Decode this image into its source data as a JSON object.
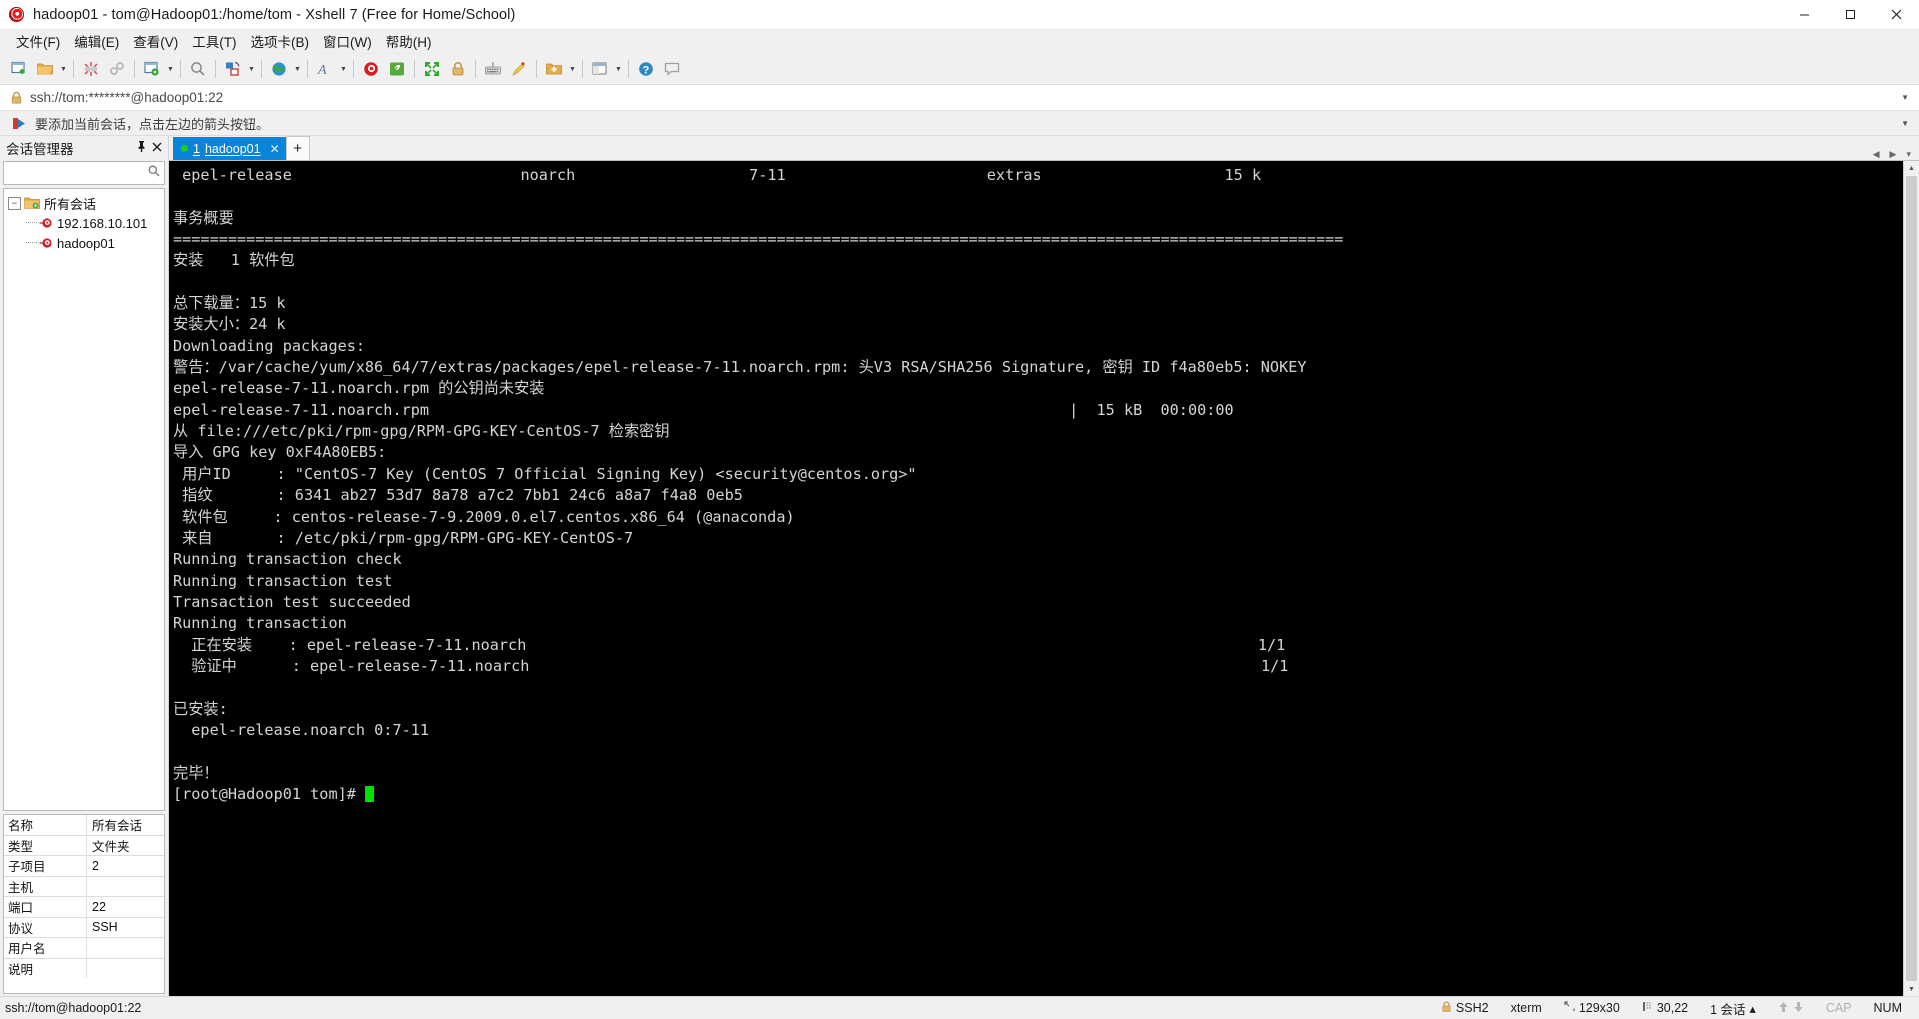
{
  "window": {
    "title": "hadoop01 - tom@Hadoop01:/home/tom - Xshell 7 (Free for Home/School)",
    "app_icon": "xshell-spiral-icon",
    "minimize_label": "─",
    "maximize_label": "☐",
    "close_label": "✕"
  },
  "menu": {
    "items": [
      {
        "label": "文件(F)",
        "name": "menu-file"
      },
      {
        "label": "编辑(E)",
        "name": "menu-edit"
      },
      {
        "label": "查看(V)",
        "name": "menu-view"
      },
      {
        "label": "工具(T)",
        "name": "menu-tools"
      },
      {
        "label": "选项卡(B)",
        "name": "menu-tabs"
      },
      {
        "label": "窗口(W)",
        "name": "menu-window"
      },
      {
        "label": "帮助(H)",
        "name": "menu-help"
      }
    ]
  },
  "toolbar": {
    "buttons": [
      "new-session-icon",
      "open-folder-icon",
      "separator",
      "disconnect-icon",
      "link-icon",
      "separator",
      "session-properties-icon",
      "separator",
      "find-icon",
      "separator",
      "transfer-icon",
      "separator",
      "globe-icon",
      "separator",
      "font-icon",
      "separator",
      "xshell-icon",
      "xftp-icon",
      "separator",
      "fullscreen-icon",
      "lock-icon",
      "separator",
      "keyboard-icon",
      "highlighter-icon",
      "separator",
      "add-to-folder-icon",
      "separator",
      "layout-icon",
      "separator",
      "help-icon",
      "comment-icon"
    ]
  },
  "address": {
    "lock_icon": "lock-icon",
    "value": "ssh://tom:********@hadoop01:22",
    "caret_icon": "chevron-down-icon"
  },
  "notice": {
    "icon": "red-arrow-icon",
    "text": "要添加当前会话，点击左边的箭头按钮。",
    "caret_icon": "chevron-down-icon"
  },
  "sidebar": {
    "title": "会话管理器",
    "pin_icon": "pin-icon",
    "close_icon": "close-icon",
    "search_placeholder": "",
    "search_icon": "search-icon",
    "tree": {
      "root": {
        "label": "所有会话",
        "icon": "folder-icon",
        "expander": "−"
      },
      "children": [
        {
          "label": "192.168.10.101",
          "icon": "session-icon"
        },
        {
          "label": "hadoop01",
          "icon": "session-icon"
        }
      ]
    },
    "properties": [
      {
        "key": "名称",
        "value": "所有会话"
      },
      {
        "key": "类型",
        "value": "文件夹"
      },
      {
        "key": "子项目",
        "value": "2"
      },
      {
        "key": "主机",
        "value": ""
      },
      {
        "key": "端口",
        "value": "22"
      },
      {
        "key": "协议",
        "value": "SSH"
      },
      {
        "key": "用户名",
        "value": ""
      },
      {
        "key": "说明",
        "value": ""
      }
    ]
  },
  "tabs": {
    "active": {
      "index": "1",
      "label": "hadoop01",
      "close_label": "✕",
      "status_dot": "connected"
    },
    "new_tab_label": "+",
    "nav_left": "◀",
    "nav_right": "▶",
    "nav_menu": "▾"
  },
  "terminal": {
    "lines": [
      " epel-release                         noarch                   7-11                      extras                    15 k",
      "",
      "事务概要",
      "================================================================================================================================",
      "安装   1 软件包",
      "",
      "总下载量：15 k",
      "安装大小：24 k",
      "Downloading packages:",
      "警告：/var/cache/yum/x86_64/7/extras/packages/epel-release-7-11.noarch.rpm: 头V3 RSA/SHA256 Signature, 密钥 ID f4a80eb5: NOKEY",
      "epel-release-7-11.noarch.rpm 的公钥尚未安装",
      "epel-release-7-11.noarch.rpm                                                                      |  15 kB  00:00:00",
      "从 file:///etc/pki/rpm-gpg/RPM-GPG-KEY-CentOS-7 检索密钥",
      "导入 GPG key 0xF4A80EB5:",
      " 用户ID     : \"CentOS-7 Key (CentOS 7 Official Signing Key) <security@centos.org>\"",
      " 指纹       : 6341 ab27 53d7 8a78 a7c2 7bb1 24c6 a8a7 f4a8 0eb5",
      " 软件包     : centos-release-7-9.2009.0.el7.centos.x86_64 (@anaconda)",
      " 来自       : /etc/pki/rpm-gpg/RPM-GPG-KEY-CentOS-7",
      "Running transaction check",
      "Running transaction test",
      "Transaction test succeeded",
      "Running transaction",
      "  正在安装    : epel-release-7-11.noarch                                                                                1/1",
      "  验证中      : epel-release-7-11.noarch                                                                                1/1",
      "",
      "已安装:",
      "  epel-release.noarch 0:7-11",
      "",
      "完毕！"
    ],
    "prompt": "[root@Hadoop01 tom]# ",
    "cursor": "block-cursor"
  },
  "statusbar": {
    "left": "ssh://tom@hadoop01:22",
    "lock_icon": "lock-icon",
    "protocol": "SSH2",
    "term_type": "xterm",
    "size_icon": "resize-icon",
    "size": "129x30",
    "cursor_icon": "cursor-pos-icon",
    "cursor_pos": "30,22",
    "sessions": "1 会话",
    "sessions_caret": "▴",
    "up_icon": "↑",
    "down_icon": "↓",
    "cap": "CAP",
    "num": "NUM"
  },
  "colors": {
    "accent": "#0a84d8",
    "terminal_bg": "#000000",
    "terminal_fg": "#d4d4d4",
    "cursor": "#00e000",
    "chrome": "#f0f0f0"
  }
}
